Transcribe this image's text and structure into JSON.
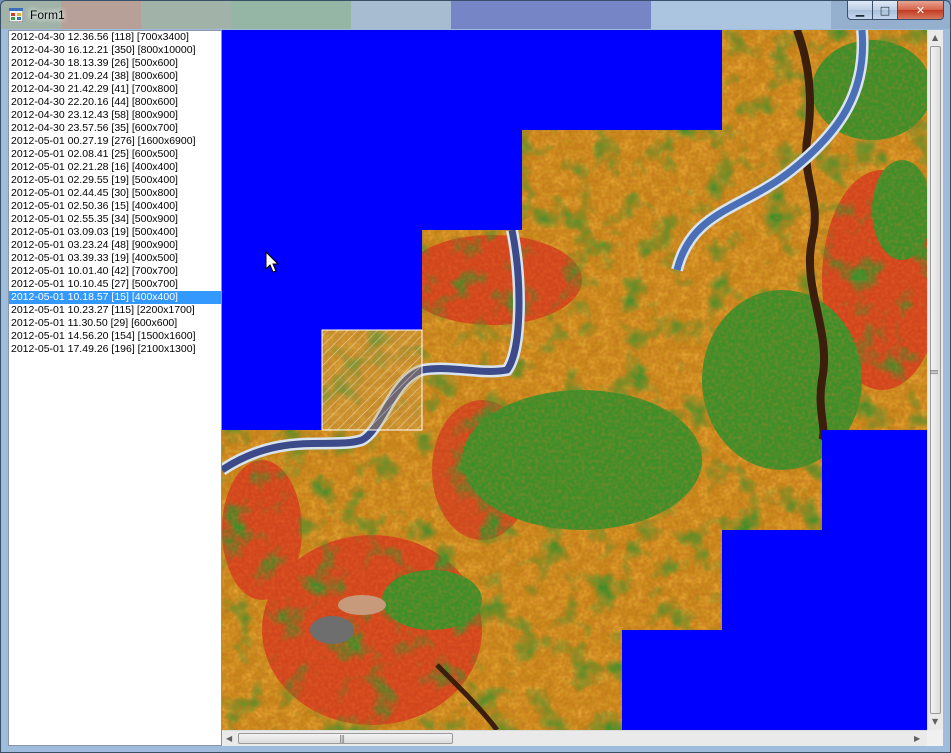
{
  "window": {
    "title": "Form1",
    "minimize_label": "▁",
    "maximize_label": "□",
    "close_label": "✕"
  },
  "list": {
    "selected_index": 19,
    "items": [
      "2012-04-30 12.36.56 [118] [700x3400]",
      "2012-04-30 16.12.21 [350] [800x10000]",
      "2012-04-30 18.13.39 [26] [500x600]",
      "2012-04-30 21.09.24 [38] [800x600]",
      "2012-04-30 21.42.29 [41] [700x800]",
      "2012-04-30 22.20.16 [44] [800x600]",
      "2012-04-30 23.12.43 [58] [800x900]",
      "2012-04-30 23.57.56 [35] [600x700]",
      "2012-05-01 00.27.19 [276] [1600x6900]",
      "2012-05-01 02.08.41 [25] [600x500]",
      "2012-05-01 02.21.28 [16] [400x400]",
      "2012-05-01 02.29.55 [19] [500x400]",
      "2012-05-01 02.44.45 [30] [500x800]",
      "2012-05-01 02.50.36 [15] [400x400]",
      "2012-05-01 02.55.35 [34] [500x900]",
      "2012-05-01 03.09.03 [19] [500x400]",
      "2012-05-01 03.23.24 [48] [900x900]",
      "2012-05-01 03.39.33 [19] [400x500]",
      "2012-05-01 10.01.40 [42] [700x700]",
      "2012-05-01 10.10.45 [27] [500x700]",
      "2012-05-01 10.18.57 [15] [400x400]",
      "2012-05-01 10.23.27 [115] [2200x1700]",
      "2012-05-01 11.30.50 [29] [600x600]",
      "2012-05-01 14.56.20 [154] [1500x1600]",
      "2012-05-01 17.49.26 [196] [2100x1300]"
    ]
  },
  "colors": {
    "water": "#0000ff",
    "terrain_orange": "#c98a1e",
    "terrain_red": "#d2461e",
    "terrain_green": "#3d8f2a",
    "selection": "#3399ff"
  },
  "scroll": {
    "vertical_arrow_up": "▲",
    "vertical_arrow_down": "▼",
    "horizontal_arrow_left": "◀",
    "horizontal_arrow_right": "▶",
    "grip": "|||"
  },
  "icons": {
    "app": "app-icon",
    "cursor": "mouse-pointer-icon"
  }
}
